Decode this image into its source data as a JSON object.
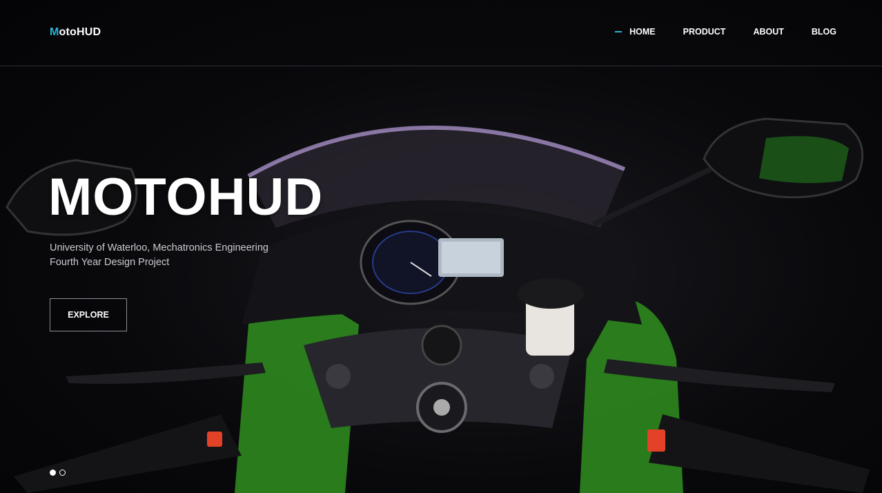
{
  "brand": {
    "logo_first": "M",
    "logo_rest": "otoHUD",
    "accent_color": "#22b7d6"
  },
  "nav": {
    "items": [
      {
        "label": "HOME",
        "active": true
      },
      {
        "label": "PRODUCT",
        "active": false
      },
      {
        "label": "ABOUT",
        "active": false
      },
      {
        "label": "BLOG",
        "active": false
      }
    ]
  },
  "hero": {
    "title": "MOTOHUD",
    "subtitle_line1": "University of Waterloo, Mechatronics Engineering",
    "subtitle_line2": "Fourth Year Design Project",
    "cta_label": "EXPLORE",
    "background_image": "motorcycle-cockpit-photo"
  },
  "carousel": {
    "slide_count": 2,
    "active_index": 0
  }
}
